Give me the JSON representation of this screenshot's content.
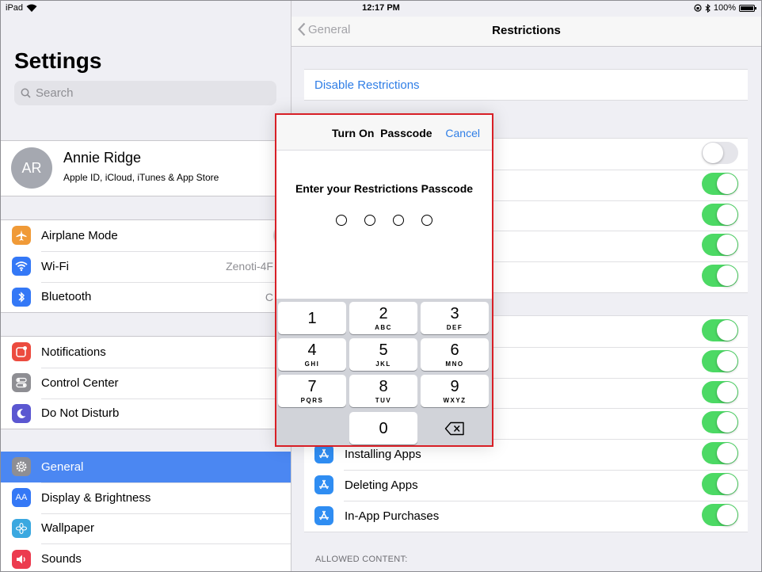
{
  "status_bar": {
    "device": "iPad",
    "time": "12:17 PM",
    "battery": "100%",
    "battery_level": 1.0
  },
  "sidebar": {
    "title": "Settings",
    "search_placeholder": "Search",
    "profile": {
      "initials": "AR",
      "name": "Annie Ridge",
      "subtitle": "Apple ID, iCloud, iTunes & App Store"
    },
    "groups": [
      {
        "items": [
          {
            "label": "Airplane Mode",
            "icon": "airplane-icon",
            "color": "#f09a37",
            "toggle": false
          },
          {
            "label": "Wi-Fi",
            "icon": "wifi-icon",
            "color": "#3478f6",
            "value": "Zenoti-4F"
          },
          {
            "label": "Bluetooth",
            "icon": "bluetooth-icon",
            "color": "#3478f6",
            "value": "C"
          }
        ]
      },
      {
        "items": [
          {
            "label": "Notifications",
            "icon": "notifications-icon",
            "color": "#ec4b3f"
          },
          {
            "label": "Control Center",
            "icon": "control-center-icon",
            "color": "#8e8e93"
          },
          {
            "label": "Do Not Disturb",
            "icon": "moon-icon",
            "color": "#5b57d1"
          }
        ]
      },
      {
        "items": [
          {
            "label": "General",
            "icon": "gear-icon",
            "color": "#8e8e93",
            "selected": true
          },
          {
            "label": "Display & Brightness",
            "icon": "display-icon",
            "color": "#3478f6"
          },
          {
            "label": "Wallpaper",
            "icon": "wallpaper-icon",
            "color": "#3aa8e0"
          },
          {
            "label": "Sounds",
            "icon": "sounds-icon",
            "color": "#ec3b4f"
          }
        ]
      }
    ]
  },
  "detail": {
    "back_label": "General",
    "title": "Restrictions",
    "disable_label": "Disable Restrictions",
    "app_rows": [
      {
        "label": "Installing Apps",
        "icon": "app-store-icon",
        "on": true
      },
      {
        "label": "Deleting Apps",
        "icon": "app-store-icon",
        "on": true
      },
      {
        "label": "In-App Purchases",
        "icon": "app-store-icon",
        "on": true
      }
    ],
    "section_header": "ALLOWED CONTENT:"
  },
  "modal": {
    "title": "Turn On  Passcode",
    "cancel_label": "Cancel",
    "prompt": "Enter your Restrictions Passcode",
    "digits_entered": 0,
    "keys": [
      {
        "num": "1",
        "letters": ""
      },
      {
        "num": "2",
        "letters": "ABC"
      },
      {
        "num": "3",
        "letters": "DEF"
      },
      {
        "num": "4",
        "letters": "GHI"
      },
      {
        "num": "5",
        "letters": "JKL"
      },
      {
        "num": "6",
        "letters": "MNO"
      },
      {
        "num": "7",
        "letters": "PQRS"
      },
      {
        "num": "8",
        "letters": "TUV"
      },
      {
        "num": "9",
        "letters": "WXYZ"
      },
      {
        "num": "0",
        "letters": ""
      }
    ],
    "delete_icon": "delete-backspace-icon"
  },
  "colors": {
    "accent": "#2f7ee6",
    "toggle_on": "#4cd964",
    "highlight_border": "#d81f26",
    "selected_row": "#4b87f2"
  }
}
